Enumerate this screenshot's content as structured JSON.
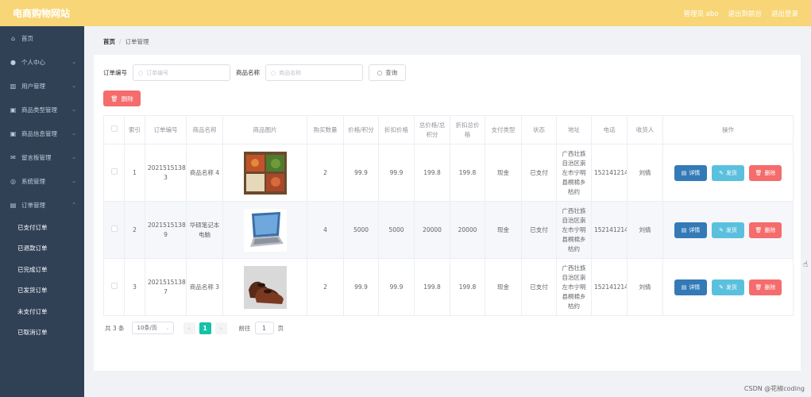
{
  "header": {
    "brand": "电商购物网站",
    "admin": "管理员 abo",
    "backend": "退出到前台",
    "logout": "退出登录"
  },
  "sidebar": {
    "items": [
      {
        "label": "首页",
        "icon": "home-icon"
      },
      {
        "label": "个人中心",
        "icon": "user-icon"
      },
      {
        "label": "用户管理",
        "icon": "bar-chart-icon"
      },
      {
        "label": "商品类型管理",
        "icon": "box-icon"
      },
      {
        "label": "商品信息管理",
        "icon": "box-icon"
      },
      {
        "label": "留言板管理",
        "icon": "mail-icon"
      },
      {
        "label": "系统管理",
        "icon": "settings-icon"
      },
      {
        "label": "订单管理",
        "icon": "document-icon"
      }
    ],
    "sub_items": [
      "已支付订单",
      "已退款订单",
      "已完成订单",
      "已发货订单",
      "未支付订单",
      "已取消订单"
    ]
  },
  "breadcrumb": {
    "home": "首页",
    "sep": "/",
    "current": "订单管理"
  },
  "search": {
    "order_label": "订单编号",
    "order_placeholder": "订单编号",
    "product_label": "商品名称",
    "product_placeholder": "商品名称",
    "query_button": "查询"
  },
  "bulk_delete": "删除",
  "table": {
    "headers": [
      "",
      "索引",
      "订单编号",
      "商品名称",
      "商品图片",
      "购买数量",
      "价格/积分",
      "折扣价格",
      "总价格/总积分",
      "折扣总价格",
      "支付类型",
      "状态",
      "地址",
      "电话",
      "收货人",
      "操作"
    ],
    "rows": [
      {
        "index": "1",
        "order_no": "202151513874618576 3",
        "name": "商品名称 4",
        "image": "food-tray",
        "qty": "2",
        "price": "99.9",
        "discount": "99.9",
        "total": "199.8",
        "discount_total": "199.8",
        "pay_type": "现金",
        "status": "已支付",
        "address": "广西壮族自治区崇左市宁明县桐棉乡枯约",
        "phone": "15214121411",
        "receiver": "刘倩"
      },
      {
        "index": "2",
        "order_no": "202151513874547045 9",
        "name": "华硕笔记本电脑",
        "image": "laptop",
        "qty": "4",
        "price": "5000",
        "discount": "5000",
        "total": "20000",
        "discount_total": "20000",
        "pay_type": "现金",
        "status": "已支付",
        "address": "广西壮族自治区崇左市宁明县桐棉乡枯约",
        "phone": "15214121411",
        "receiver": "刘倩"
      },
      {
        "index": "3",
        "order_no": "202151513874650381 7",
        "name": "商品名称 3",
        "image": "leather-shoes",
        "qty": "2",
        "price": "99.9",
        "discount": "99.9",
        "total": "199.8",
        "discount_total": "199.8",
        "pay_type": "现金",
        "status": "已支付",
        "address": "广西壮族自治区崇左市宁明县桐棉乡枯约",
        "phone": "15214121411",
        "receiver": "刘倩"
      }
    ],
    "ops": {
      "detail": "详情",
      "ship": "发货",
      "delete": "删除"
    }
  },
  "pagination": {
    "total": "共 3 条",
    "page_size": "10条/页",
    "current_page": "1",
    "goto_label": "前往",
    "goto_value": "1",
    "page_unit": "页"
  },
  "watermark": "CSDN @花椒coding",
  "colors": {
    "header_bg": "#f8d677",
    "sidebar_bg": "#304156",
    "danger": "#f56c6c",
    "primary": "#337ab7",
    "info": "#5bc0de",
    "page_active": "#13c2a7"
  }
}
